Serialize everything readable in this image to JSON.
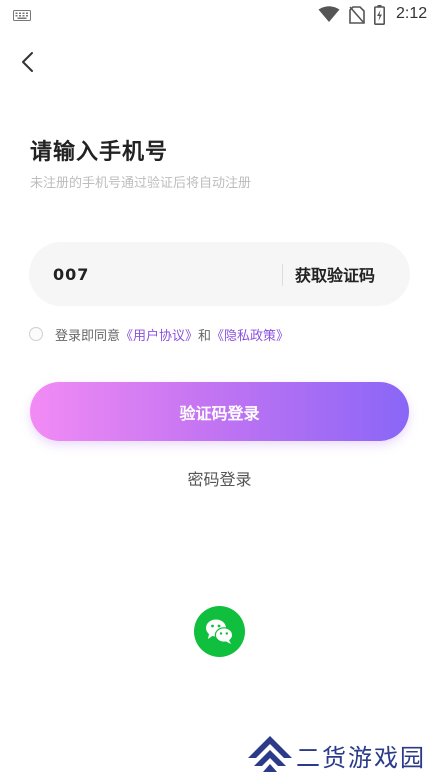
{
  "status_bar": {
    "time": "2:12",
    "icons": [
      "keyboard-icon",
      "wifi-icon",
      "no-sim-icon",
      "battery-charging-icon"
    ]
  },
  "header": {
    "back_icon": "chevron-left-icon"
  },
  "title": "请输入手机号",
  "subtitle": "未注册的手机号通过验证后将自动注册",
  "phone_field": {
    "value": "007",
    "placeholder": ""
  },
  "get_code_label": "获取验证码",
  "agreement": {
    "checked": false,
    "prefix": "登录即同意",
    "user_agreement": "《用户协议》",
    "and": "和",
    "privacy_policy": "《隐私政策》"
  },
  "login_button_label": "验证码登录",
  "password_login_label": "密码登录",
  "wechat": {
    "icon": "wechat-icon"
  },
  "watermark": {
    "text": "二货游戏园"
  },
  "colors": {
    "accent_start": "#f28bf5",
    "accent_end": "#8a66f7",
    "link": "#8a52e0",
    "wechat": "#0fbf3d"
  }
}
